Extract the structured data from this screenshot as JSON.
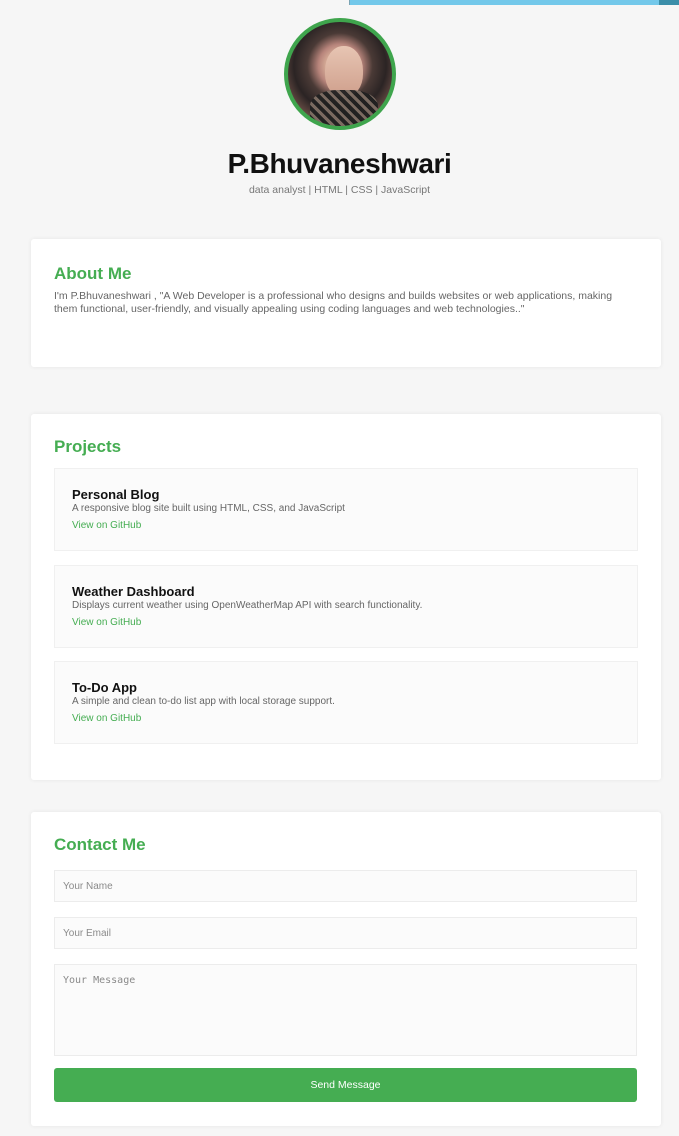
{
  "profile": {
    "name": "P.Bhuvaneshwari",
    "subtitle": "data analyst | HTML | CSS | JavaScript"
  },
  "about": {
    "title": "About Me",
    "text": "I'm P.Bhuvaneshwari , \"A Web Developer is a professional who designs and builds websites or web applications, making them functional, user-friendly, and visually appealing using coding languages and web technologies..\""
  },
  "projects": {
    "title": "Projects",
    "items": [
      {
        "title": "Personal Blog",
        "description": "A responsive blog site built using HTML, CSS, and JavaScript",
        "link_label": "View on GitHub"
      },
      {
        "title": "Weather Dashboard",
        "description": "Displays current weather using OpenWeatherMap API with search functionality.",
        "link_label": "View on GitHub"
      },
      {
        "title": "To-Do App",
        "description": "A simple and clean to-do list app with local storage support.",
        "link_label": "View on GitHub"
      }
    ]
  },
  "contact": {
    "title": "Contact Me",
    "name_placeholder": "Your Name",
    "email_placeholder": "Your Email",
    "message_placeholder": "Your Message",
    "button_label": "Send Message"
  },
  "colors": {
    "accent": "#45ad52",
    "background": "#f6f6f6",
    "card": "#ffffff"
  }
}
